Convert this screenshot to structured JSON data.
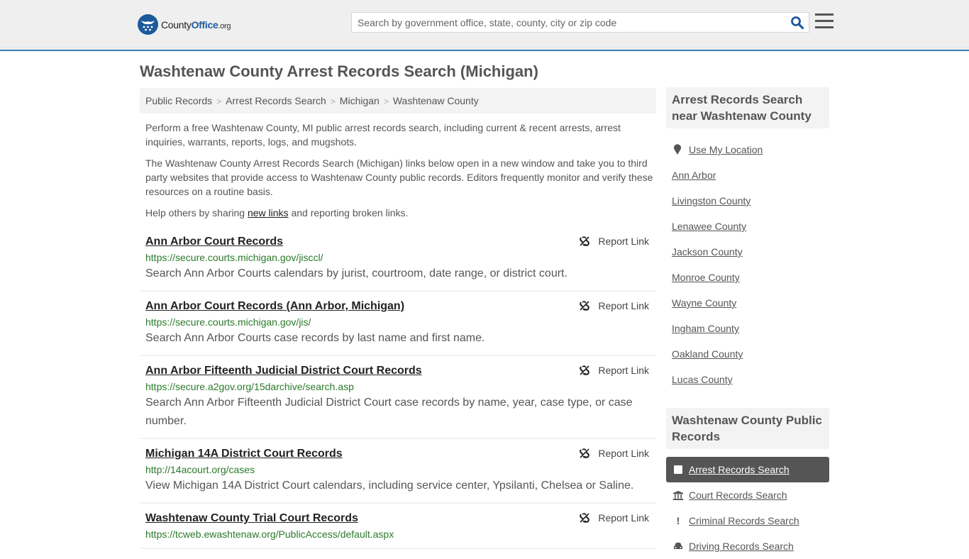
{
  "header": {
    "logo": {
      "name_part1": "County",
      "name_part2": "Office",
      "tld": ".org"
    },
    "search_placeholder": "Search by government office, state, county, city or zip code",
    "search_value": ""
  },
  "page_title": "Washtenaw County Arrest Records Search (Michigan)",
  "breadcrumb": [
    "Public Records",
    "Arrest Records Search",
    "Michigan",
    "Washtenaw County"
  ],
  "intro": {
    "p1": "Perform a free Washtenaw County, MI public arrest records search, including current & recent arrests, arrest inquiries, warrants, reports, logs, and mugshots.",
    "p2": "The Washtenaw County Arrest Records Search (Michigan) links below open in a new window and take you to third party websites that provide access to Washtenaw County public records. Editors frequently monitor and verify these resources on a routine basis.",
    "p3_before": "Help others by sharing ",
    "p3_link": "new links",
    "p3_after": " and reporting broken links."
  },
  "report_label": "Report Link",
  "records": [
    {
      "title": "Ann Arbor Court Records",
      "url": "https://secure.courts.michigan.gov/jisccl/",
      "desc": "Search Ann Arbor Courts calendars by jurist, courtroom, date range, or district court."
    },
    {
      "title": "Ann Arbor Court Records (Ann Arbor, Michigan)",
      "url": "https://secure.courts.michigan.gov/jis/",
      "desc": "Search Ann Arbor Courts case records by last name and first name."
    },
    {
      "title": "Ann Arbor Fifteenth Judicial District Court Records",
      "url": "https://secure.a2gov.org/15darchive/search.asp",
      "desc": "Search Ann Arbor Fifteenth Judicial District Court case records by name, year, case type, or case number."
    },
    {
      "title": "Michigan 14A District Court Records",
      "url": "http://14acourt.org/cases",
      "desc": "View Michigan 14A District Court calendars, including service center, Ypsilanti, Chelsea or Saline."
    },
    {
      "title": "Washtenaw County Trial Court Records",
      "url": "https://tcweb.ewashtenaw.org/PublicAccess/default.aspx",
      "desc": ""
    }
  ],
  "sidebar": {
    "nearby_title": "Arrest Records Search near Washtenaw County",
    "use_location": "Use My Location",
    "nearby": [
      "Ann Arbor",
      "Livingston County",
      "Lenawee County",
      "Jackson County",
      "Monroe County",
      "Wayne County",
      "Ingham County",
      "Oakland County",
      "Lucas County"
    ],
    "public_records_title": "Washtenaw County Public Records",
    "public_records": [
      {
        "label": "Arrest Records Search",
        "icon": "square-icon",
        "active": true
      },
      {
        "label": "Court Records Search",
        "icon": "courthouse-icon",
        "active": false
      },
      {
        "label": "Criminal Records Search",
        "icon": "exclamation-icon",
        "active": false
      },
      {
        "label": "Driving Records Search",
        "icon": "car-icon",
        "active": false
      }
    ]
  },
  "colors": {
    "brand_blue": "#1d5a9c",
    "header_rule": "#3a7bab",
    "url_green": "#2a7a2a",
    "active_bg": "#555555"
  }
}
